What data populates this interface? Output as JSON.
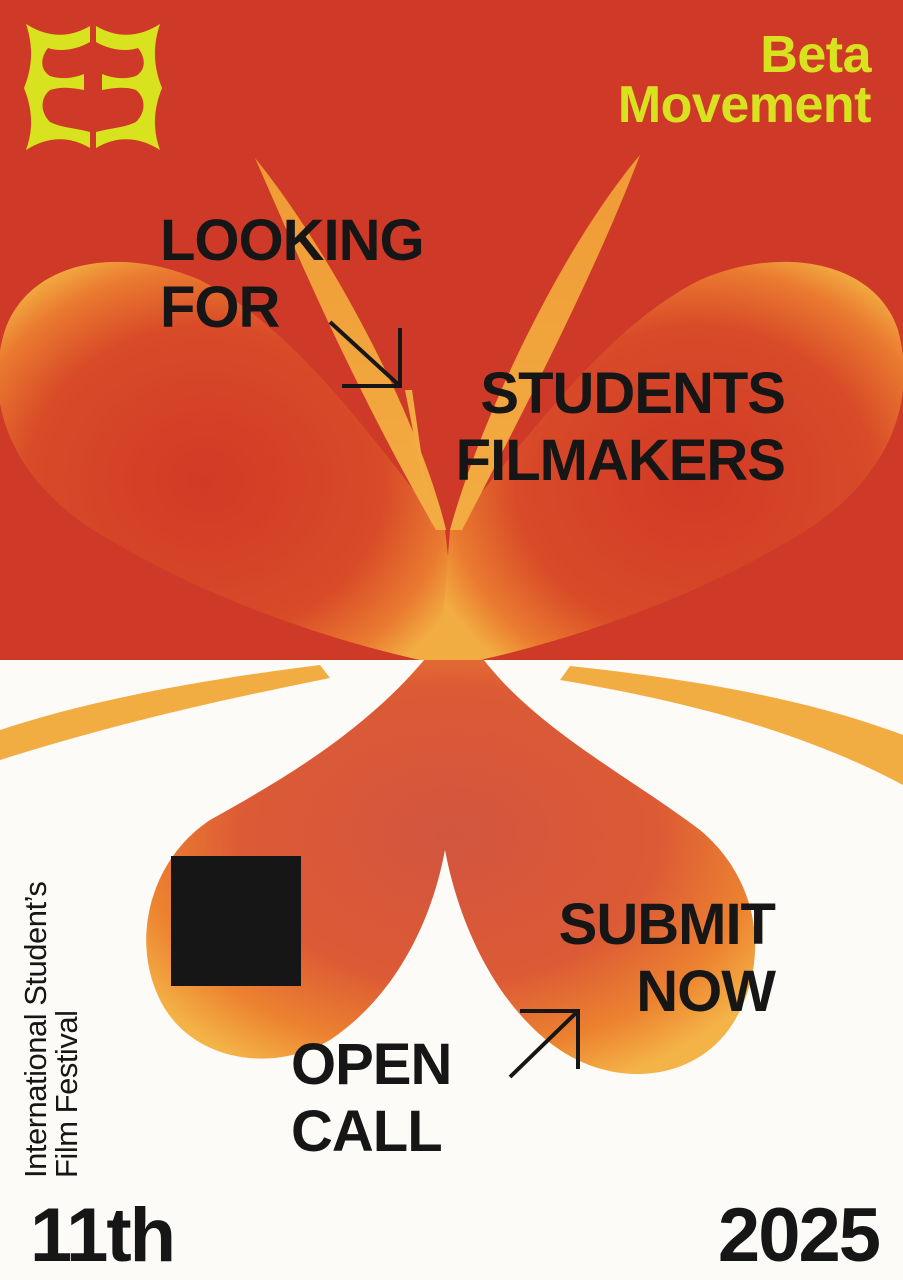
{
  "brand": {
    "name_line1": "Beta",
    "name_line2": "Movement",
    "logo_icon": "beta-movement-monogram-icon"
  },
  "headline": {
    "line1": "LOOKING",
    "line2": "FOR",
    "line3": "STUDENTS",
    "line4": "FILMAKERS"
  },
  "call_to_action": {
    "line1": "SUBMIT",
    "line2": "NOW"
  },
  "open_call": {
    "line1": "OPEN",
    "line2": "CALL"
  },
  "festival": {
    "line1": "International Student’s",
    "line2": "Film Festival",
    "edition": "11th",
    "year": "2025"
  },
  "icons": {
    "arrow_down_right": "arrow-down-right-icon",
    "arrow_up_right": "arrow-up-right-icon",
    "square": "black-square-icon"
  },
  "colors": {
    "top_background": "#cf3a28",
    "bottom_background": "#fdfbf7",
    "accent_lime": "#d9e21f",
    "flower_orange": "#f0a83c",
    "flower_red": "#d4402a",
    "text_dark": "#161616"
  }
}
